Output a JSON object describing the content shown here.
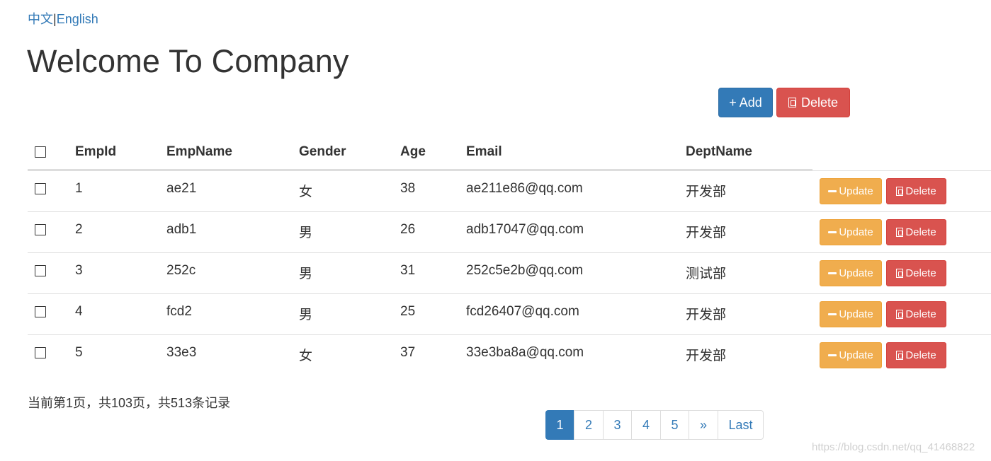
{
  "lang": {
    "zh": "中文",
    "sep": "|",
    "en": "English"
  },
  "title": "Welcome To Company",
  "toolbar": {
    "add_label": "+ Add",
    "delete_label": "Delete"
  },
  "table": {
    "headers": [
      "EmpId",
      "EmpName",
      "Gender",
      "Age",
      "Email",
      "DeptName"
    ],
    "rows": [
      {
        "id": "1",
        "name": "ae21",
        "gender": "女",
        "age": "38",
        "email": "ae211e86@qq.com",
        "dept": "开发部"
      },
      {
        "id": "2",
        "name": "adb1",
        "gender": "男",
        "age": "26",
        "email": "adb17047@qq.com",
        "dept": "开发部"
      },
      {
        "id": "3",
        "name": "252c",
        "gender": "男",
        "age": "31",
        "email": "252c5e2b@qq.com",
        "dept": "测试部"
      },
      {
        "id": "4",
        "name": "fcd2",
        "gender": "男",
        "age": "25",
        "email": "fcd26407@qq.com",
        "dept": "开发部"
      },
      {
        "id": "5",
        "name": "33e3",
        "gender": "女",
        "age": "37",
        "email": "33e3ba8a@qq.com",
        "dept": "开发部"
      }
    ],
    "update_label": "Update",
    "delete_label": "Delete"
  },
  "page_info": "当前第1页，共103页，共513条记录",
  "pagination": {
    "pages": [
      "1",
      "2",
      "3",
      "4",
      "5"
    ],
    "active": "1",
    "next": "»",
    "last": "Last"
  },
  "watermark": "https://blog.csdn.net/qq_41468822",
  "colors": {
    "primary": "#337ab7",
    "danger": "#d9534f",
    "warning": "#f0ad4e"
  }
}
